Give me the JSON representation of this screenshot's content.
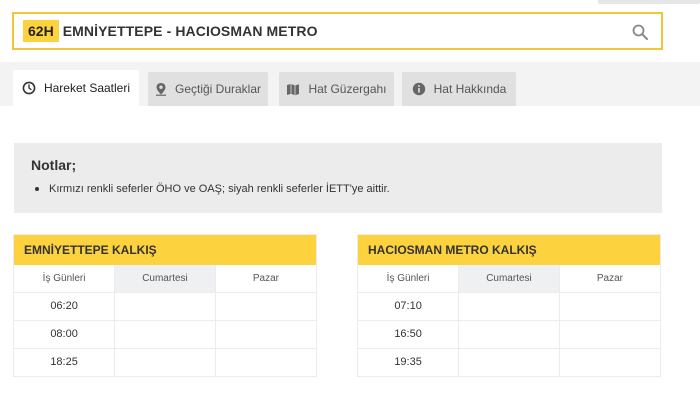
{
  "search": {
    "route_code": "62H",
    "route_name": "EMNİYETTEPE - HACIOSMAN METRO"
  },
  "tabs": [
    {
      "label": "Hareket Saatleri",
      "icon": "clock-icon",
      "active": true
    },
    {
      "label": "Geçtiği Duraklar",
      "icon": "map-pin-icon",
      "active": false
    },
    {
      "label": "Hat Güzergahı",
      "icon": "map-icon",
      "active": false
    },
    {
      "label": "Hat Hakkında",
      "icon": "info-icon",
      "active": false
    }
  ],
  "notes": {
    "title": "Notlar;",
    "items": [
      "Kırmızı renkli seferler ÖHO ve OAŞ; siyah renkli seferler İETT'ye aittir."
    ]
  },
  "schedules": [
    {
      "title": "EMNİYETTEPE KALKIŞ",
      "columns": [
        "İş Günleri",
        "Cumartesi",
        "Pazar"
      ],
      "rows": [
        [
          "06:20",
          "",
          ""
        ],
        [
          "08:00",
          "",
          ""
        ],
        [
          "18:25",
          "",
          ""
        ]
      ]
    },
    {
      "title": "HACIOSMAN METRO KALKIŞ",
      "columns": [
        "İş Günleri",
        "Cumartesi",
        "Pazar"
      ],
      "rows": [
        [
          "07:10",
          "",
          ""
        ],
        [
          "16:50",
          "",
          ""
        ],
        [
          "19:35",
          "",
          ""
        ]
      ]
    }
  ],
  "colors": {
    "accent": "#fcd23f",
    "border_accent": "#f2c53d",
    "notes_bg": "#ececec"
  }
}
